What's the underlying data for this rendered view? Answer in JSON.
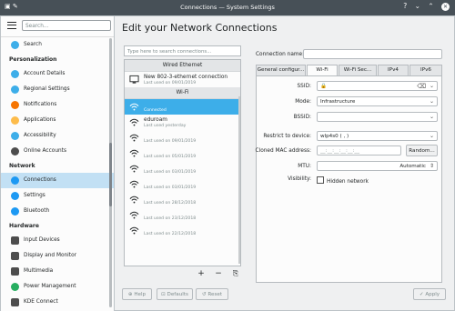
{
  "titlebar": {
    "title": "Connections — System Settings",
    "left_icons": "▣ ✎",
    "right_icons": "? ⌄ ⌃",
    "close_glyph": "✕"
  },
  "sidebar": {
    "search_placeholder": "Search...",
    "search_item": "Search",
    "sections": [
      {
        "title": "Personalization",
        "items": [
          {
            "label": "Account Details",
            "icon": "user-icon",
            "color": "#3daee9"
          },
          {
            "label": "Regional Settings",
            "icon": "flag-icon",
            "color": "#3daee9"
          },
          {
            "label": "Notifications",
            "icon": "bell-icon",
            "color": "#f67400"
          },
          {
            "label": "Applications",
            "icon": "star-icon",
            "color": "#fdbc4b"
          },
          {
            "label": "Accessibility",
            "icon": "accessibility-icon",
            "color": "#3daee9"
          },
          {
            "label": "Online Accounts",
            "icon": "globe-icon",
            "color": "#4d4d4d"
          }
        ]
      },
      {
        "title": "Network",
        "items": [
          {
            "label": "Connections",
            "icon": "network-globe-icon",
            "color": "#1d99f3"
          },
          {
            "label": "Settings",
            "icon": "network-settings-icon",
            "color": "#1d99f3"
          },
          {
            "label": "Bluetooth",
            "icon": "bluetooth-icon",
            "color": "#1d99f3"
          }
        ]
      },
      {
        "title": "Hardware",
        "items": [
          {
            "label": "Input Devices",
            "icon": "keyboard-icon",
            "color": "#4d4d4d"
          },
          {
            "label": "Display and Monitor",
            "icon": "monitor-icon",
            "color": "#4d4d4d"
          },
          {
            "label": "Multimedia",
            "icon": "multimedia-icon",
            "color": "#4d4d4d"
          },
          {
            "label": "Power Management",
            "icon": "power-icon",
            "color": "#27ae60"
          },
          {
            "label": "KDE Connect",
            "icon": "phone-icon",
            "color": "#4d4d4d"
          }
        ]
      }
    ]
  },
  "main": {
    "title": "Edit your Network Connections"
  },
  "connections": {
    "search_placeholder": "Type here to search connections...",
    "wired_header": "Wired Ethernet",
    "wired": [
      {
        "name": "New 802-3-ethernet connection",
        "sub": "Last used on 09/01/2019"
      }
    ],
    "wifi_header": "Wi-Fi",
    "wifi": [
      {
        "name": "",
        "sub": "Connected"
      },
      {
        "name": "eduroam",
        "sub": "Last used yesterday"
      },
      {
        "name": "",
        "sub": "Last used on 09/01/2019"
      },
      {
        "name": "",
        "sub": "Last used on 05/01/2019"
      },
      {
        "name": "",
        "sub": "Last used on 03/01/2019"
      },
      {
        "name": "",
        "sub": "Last used on 03/01/2019"
      },
      {
        "name": "",
        "sub": "Last used on 28/12/2018"
      },
      {
        "name": "",
        "sub": "Last used on 23/12/2018"
      },
      {
        "name": "",
        "sub": "Last used on 22/12/2018"
      }
    ],
    "add_glyph": "+",
    "remove_glyph": "−",
    "export_glyph": "⎘"
  },
  "settings": {
    "connection_name_label": "Connection name:",
    "connection_name_value": "",
    "tabs": [
      "General configur...",
      "Wi-Fi",
      "Wi-Fi Sec...",
      "IPv4",
      "IPv6"
    ],
    "active_tab": 1,
    "ssid_label": "SSID:",
    "ssid_value": "",
    "mode_label": "Mode:",
    "mode_value": "Infrastructure",
    "bssid_label": "BSSID:",
    "bssid_value": "",
    "restrict_label": "Restrict to device:",
    "restrict_value": "wlp4s0 (               ,              )",
    "mac_label": "Cloned MAC address:",
    "mac_value": "__:__:__:__:__:__",
    "random_button": "Random...",
    "mtu_label": "MTU:",
    "mtu_value": "Automatic",
    "visibility_label": "Visibility:",
    "hidden_network_label": "Hidden network"
  },
  "footer": {
    "help": "Help",
    "defaults": "Defaults",
    "reset": "Reset",
    "apply": "Apply"
  }
}
